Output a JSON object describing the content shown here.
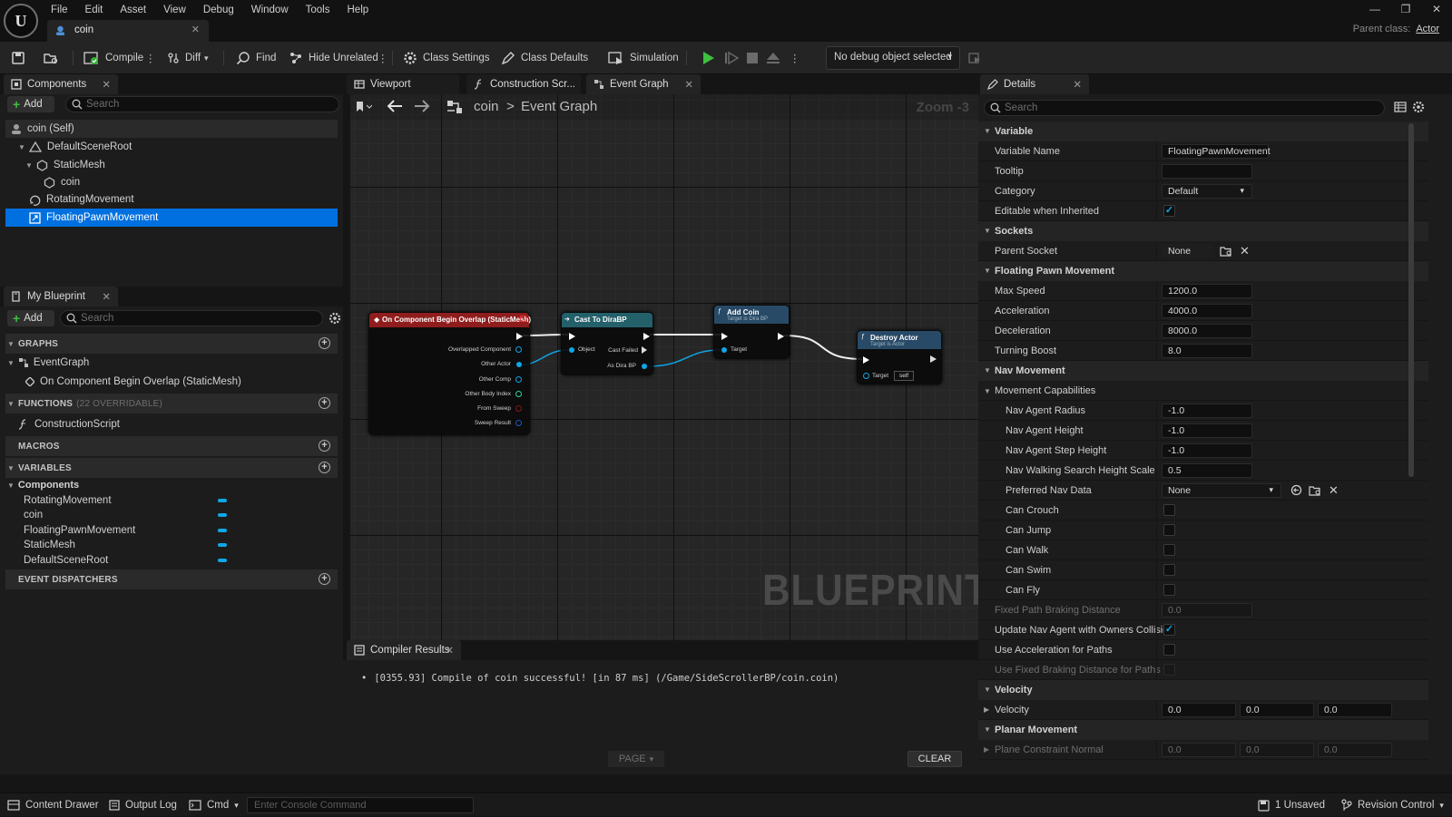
{
  "menu": [
    "File",
    "Edit",
    "Asset",
    "View",
    "Debug",
    "Window",
    "Tools",
    "Help"
  ],
  "document_tab": "coin",
  "parent_class": {
    "label": "Parent class:",
    "value": "Actor"
  },
  "window_controls": [
    "—",
    "❐",
    "✕"
  ],
  "toolbar": {
    "compile": "Compile",
    "diff": "Diff",
    "find": "Find",
    "hide_unrelated": "Hide Unrelated",
    "class_settings": "Class Settings",
    "class_defaults": "Class Defaults",
    "simulation": "Simulation",
    "debug_object": "No debug object selected"
  },
  "components_panel": {
    "tab": "Components",
    "add": "Add",
    "search_placeholder": "Search",
    "items": [
      "coin (Self)",
      "DefaultSceneRoot",
      "StaticMesh",
      "coin",
      "RotatingMovement",
      "FloatingPawnMovement"
    ]
  },
  "my_blueprint": {
    "tab": "My Blueprint",
    "add": "Add",
    "search_placeholder": "Search",
    "graphs_header": "GRAPHS",
    "event_graph": "EventGraph",
    "event_item": "On Component Begin Overlap (StaticMesh)",
    "functions_header": "FUNCTIONS",
    "functions_count": "(22 OVERRIDABLE)",
    "construction_script": "ConstructionScript",
    "macros_header": "MACROS",
    "variables_header": "VARIABLES",
    "components_group": "Components",
    "variables": [
      "RotatingMovement",
      "coin",
      "FloatingPawnMovement",
      "StaticMesh",
      "DefaultSceneRoot"
    ],
    "event_dispatchers_header": "EVENT DISPATCHERS"
  },
  "graph_tabs": [
    "Viewport",
    "Construction Scr...",
    "Event Graph"
  ],
  "graph": {
    "breadcrumb_root": "coin",
    "breadcrumb_sep": ">",
    "breadcrumb_current": "Event Graph",
    "zoom": "Zoom -3",
    "watermark": "BLUEPRINT",
    "nodes": {
      "overlap": {
        "title": "On Component Begin Overlap (StaticMesh)",
        "pins": [
          "Overlapped Component",
          "Other Actor",
          "Other Comp",
          "Other Body Index",
          "From Sweep",
          "Sweep Result"
        ]
      },
      "cast": {
        "title": "Cast To DiraBP",
        "object": "Object",
        "cast_failed": "Cast Failed",
        "as": "As Dira BP"
      },
      "add_coin": {
        "title": "Add Coin",
        "subtitle": "Target is Dira BP",
        "target": "Target"
      },
      "destroy": {
        "title": "Destroy Actor",
        "subtitle": "Target is Actor",
        "target": "Target",
        "self": "self"
      }
    }
  },
  "compiler": {
    "tab": "Compiler Results",
    "message": "[0355.93] Compile of coin successful! [in 87 ms] (/Game/SideScrollerBP/coin.coin)",
    "page": "PAGE",
    "clear": "CLEAR"
  },
  "details": {
    "tab": "Details",
    "search_placeholder": "Search",
    "variable_section": "Variable",
    "variable_name_label": "Variable Name",
    "variable_name": "FloatingPawnMovement",
    "tooltip_label": "Tooltip",
    "category_label": "Category",
    "category": "Default",
    "editable_label": "Editable when Inherited",
    "sockets_section": "Sockets",
    "parent_socket_label": "Parent Socket",
    "parent_socket": "None",
    "fpm_section": "Floating Pawn Movement",
    "max_speed_label": "Max Speed",
    "max_speed": "1200.0",
    "acceleration_label": "Acceleration",
    "acceleration": "4000.0",
    "deceleration_label": "Deceleration",
    "deceleration": "8000.0",
    "turning_boost_label": "Turning Boost",
    "turning_boost": "8.0",
    "nav_section": "Nav Movement",
    "capabilities_label": "Movement Capabilities",
    "nav_radius_label": "Nav Agent Radius",
    "nav_radius": "-1.0",
    "nav_height_label": "Nav Agent Height",
    "nav_height": "-1.0",
    "nav_step_label": "Nav Agent Step Height",
    "nav_step": "-1.0",
    "nav_walk_label": "Nav Walking Search Height Scale",
    "nav_walk": "0.5",
    "pref_nav_label": "Preferred Nav Data",
    "pref_nav": "None",
    "can_crouch": "Can Crouch",
    "can_jump": "Can Jump",
    "can_walk": "Can Walk",
    "can_swim": "Can Swim",
    "can_fly": "Can Fly",
    "fixed_path_label": "Fixed Path Braking Distance",
    "fixed_path": "0.0",
    "update_nav_label": "Update Nav Agent with Owners Collision",
    "use_accel_label": "Use Acceleration for Paths",
    "use_fixed_label": "Use Fixed Braking Distance for Paths",
    "velocity_section": "Velocity",
    "velocity_label": "Velocity",
    "velocity": [
      "0.0",
      "0.0",
      "0.0"
    ],
    "planar_section": "Planar Movement",
    "plane_normal_label": "Plane Constraint Normal",
    "plane_normal": [
      "0.0",
      "0.0",
      "0.0"
    ]
  },
  "statusbar": {
    "content_drawer": "Content Drawer",
    "output_log": "Output Log",
    "cmd": "Cmd",
    "console_placeholder": "Enter Console Command",
    "unsaved": "1 Unsaved",
    "revision": "Revision Control"
  },
  "colors": {
    "selection": "#0070e0",
    "accent_blue": "#0fa6e8",
    "event_node": "#8f1d1d",
    "cast_node": "#24606a",
    "function_node": "#284a66",
    "play_green": "#3fbf3f"
  }
}
